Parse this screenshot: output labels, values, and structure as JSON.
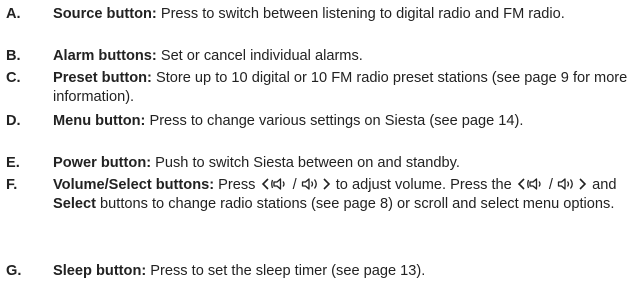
{
  "items": [
    {
      "letter": "A.",
      "term": "Source button:",
      "text": " Press to switch between listening to digital radio and FM radio."
    },
    {
      "letter": "B.",
      "term": "Alarm buttons:",
      "text": " Set or cancel individual alarms."
    },
    {
      "letter": "C.",
      "term": "Preset button:",
      "text": " Store up to 10 digital or 10 FM radio preset stations (see page 9 for more information)."
    },
    {
      "letter": "D.",
      "term": "Menu button:",
      "text": " Press to change various settings on Siesta (see page 14)."
    },
    {
      "letter": "E.",
      "term": "Power button:",
      "text": " Push to switch Siesta between on and standby."
    },
    {
      "letter": "F.",
      "term": "Volume/Select buttons:",
      "text_press": " Press ",
      "text_adjust": " to adjust volume. Press the ",
      "text_and": " and ",
      "select_label": "Select",
      "text_change": " buttons to change radio stations (see page 8) or scroll and select menu options.",
      "symbol_slash": "/"
    },
    {
      "letter": "G.",
      "term": "Sleep button:",
      "text": " Press to set the sleep timer (see page 13)."
    }
  ]
}
